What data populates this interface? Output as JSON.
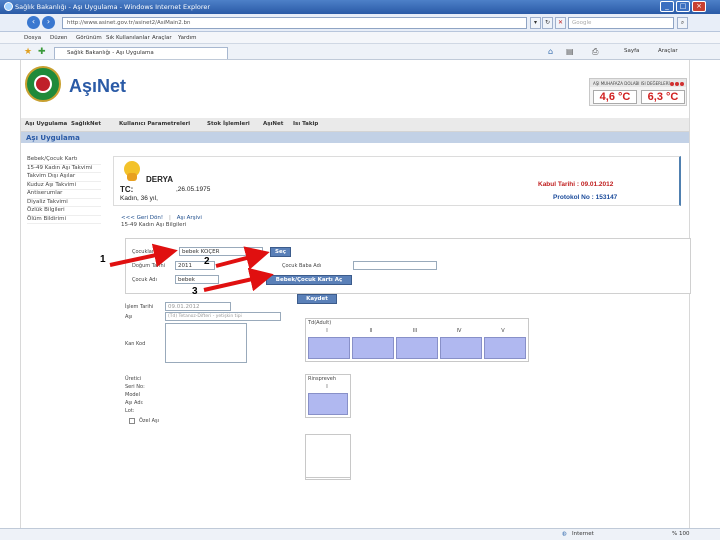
{
  "window": {
    "title": "Sağlık Bakanlığı - Aşı Uygulama - Windows Internet Explorer",
    "url": "http://www.asinet.gov.tr/asinet2/AsiMain2.bn",
    "search_placeholder": "Google",
    "menu": [
      "Dosya",
      "Düzen",
      "Görünüm",
      "Sık Kullanılanlar",
      "Araçlar",
      "Yardım"
    ],
    "tab_title": "Sağlık Bakanlığı - Aşı Uygulama",
    "commands": [
      "Sayfa",
      "Araçlar"
    ],
    "status": {
      "zone": "Internet",
      "zoom": "% 100"
    }
  },
  "header": {
    "brand": "AşıNet",
    "temp_title": "AŞI MUHAFAZA DOLABI ISI DEĞERLERİ",
    "temp_min": "4,6 °C",
    "temp_max": "6,3 °C"
  },
  "nav": [
    "Aşı Uygulama",
    "SağlıkNet",
    "Kullanıcı Parametreleri",
    "Stok İşlemleri",
    "AşıNet",
    "Isı Takip"
  ],
  "page_title": "Aşı Uygulama",
  "sidebar": [
    "Bebek/Çocuk Kartı",
    "15-49 Kadın Aşı Takvimi",
    "Takvim Dışı Aşılar",
    "Kuduz Aşı Takvimi",
    "Antiserumlar",
    "Diyaliz Takvimi",
    "Özlük Bilgileri",
    "Ölüm Bildirimi"
  ],
  "patient": {
    "name": "DERYA",
    "tc_label": "TC:",
    "birth_date": ",26.05.1975",
    "desc": "Kadın, 36 yıl,",
    "kabul_label": "Kabul Tarihi : 09.01.2012",
    "protokol_label": "Protokol No : 153147"
  },
  "tabs": {
    "back": "<<< Geri Dön!",
    "archive": "Aşı Arşivi",
    "subtitle": "15-49 Kadın Aşı Bilgileri"
  },
  "form": {
    "children_label": "Çocuklar",
    "children_value": "bebek KOÇER",
    "choose_button": "Seç",
    "birth_label": "Doğum Tarihi",
    "birth_value": "2011",
    "child_name_label": "Çocuk Adı",
    "child_name_value": "bebek",
    "mother_label": "Çocuk Baba Adı",
    "open_card_button": "Bebek/Çocuk Kartı Aç",
    "save_button": "Kaydet"
  },
  "lower": {
    "date_label": "İşlem Tarihi",
    "date_value": "09.01.2012",
    "vaccine_label": "Aşı",
    "vaccine_value": "(Td) Tetanoz-Difteri - yetişkin tipi",
    "notes_label": "Kan Kod",
    "extra_labels": [
      "Üretici",
      "Seri No:",
      "Model",
      "Aşı Adı:",
      "Lot:"
    ],
    "ozel_label": "Özel Aşı",
    "td_title": "Td(Adult)",
    "td_columns": [
      "I",
      "II",
      "III",
      "IV",
      "V"
    ],
    "rabies_title": "Rinspreveh",
    "rabies_columns": [
      "I"
    ]
  },
  "annotations": [
    "1",
    "2",
    "3"
  ],
  "colors": {
    "accent": "#2a5aa6",
    "cell": "#b0b8f0",
    "alert": "#d02020"
  }
}
